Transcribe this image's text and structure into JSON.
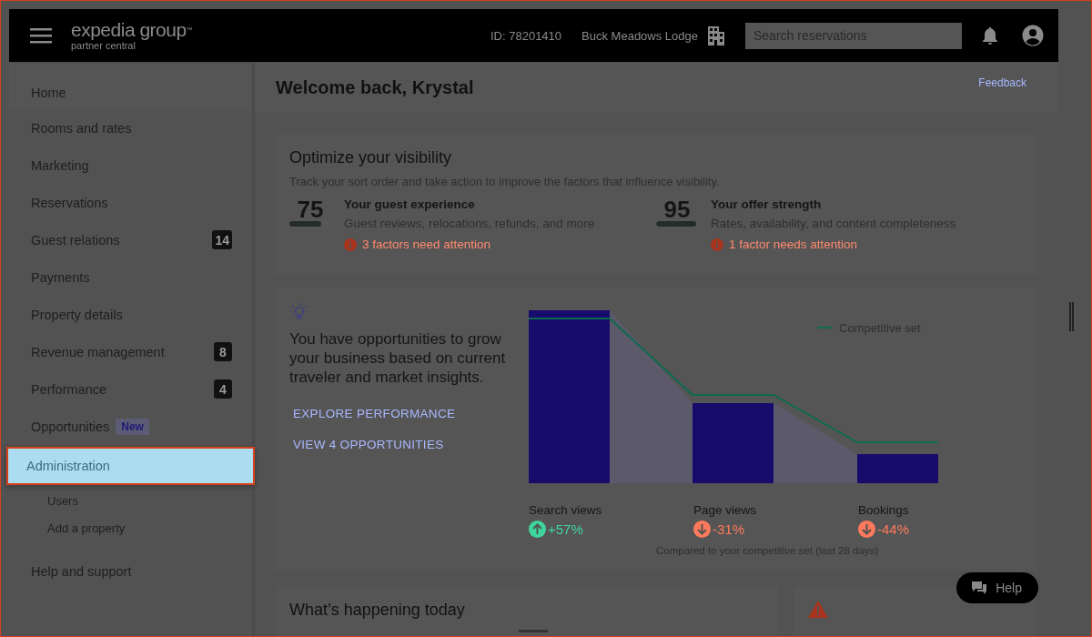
{
  "header": {
    "logo": "expedia group",
    "logo_tm": "™",
    "logo_sub": "partner central",
    "property_id": "ID: 78201410",
    "property_name": "Buck Meadows Lodge",
    "search": {
      "placeholder": "Search reservations"
    }
  },
  "sidebar": {
    "items": [
      {
        "label": "Home",
        "selected": false
      },
      {
        "label": "Rooms and rates",
        "selected": false
      },
      {
        "label": "Marketing",
        "selected": false
      },
      {
        "label": "Reservations",
        "selected": false
      },
      {
        "label": "Guest relations",
        "badge": "14",
        "selected": false
      },
      {
        "label": "Payments",
        "selected": false
      },
      {
        "label": "Property details",
        "selected": false
      },
      {
        "label": "Revenue management",
        "badge": "8",
        "selected": false
      },
      {
        "label": "Performance",
        "badge": "4",
        "selected": false
      },
      {
        "label": "Opportunities",
        "tag": "New",
        "selected": false
      },
      {
        "label": "Administration",
        "selected": true,
        "children": [
          {
            "label": "Users",
            "selected": false
          },
          {
            "label": "Add a property",
            "selected": false
          }
        ]
      },
      {
        "label": "Help and support",
        "selected": false
      }
    ]
  },
  "welcome": {
    "title": "Welcome back, Krystal",
    "feedback": "Feedback"
  },
  "visibility": {
    "title": "Optimize your visibility",
    "subtitle": "Track your sort order and take action to improve the factors that influence visibility.",
    "scores": [
      {
        "score": "75",
        "level": 0.75,
        "title": "Your guest experience",
        "description": "Guest reviews, relocations, refunds, and more",
        "alert": "3 factors need attention"
      },
      {
        "score": "95",
        "level": 0.95,
        "title": "Your offer strength",
        "description": "Rates, availability, and content completeness",
        "alert": "1 factor needs attention"
      }
    ]
  },
  "opportunities": {
    "text": "You have opportunities to grow your business based on current traveler and market insights.",
    "links": [
      "EXPLORE PERFORMANCE",
      "VIEW 4 OPPORTUNITIES"
    ],
    "legend": "Competitive set",
    "metrics": [
      {
        "label": "Search views",
        "change": "+57%",
        "kind": "up"
      },
      {
        "label": "Page views",
        "change": "-31%",
        "kind": "down"
      },
      {
        "label": "Bookings",
        "change": "-44%",
        "kind": "down"
      }
    ],
    "caption": "Compared to your competitive set (last 28 days)"
  },
  "today": {
    "title": "What’s happening today"
  },
  "help_button": "Help"
}
